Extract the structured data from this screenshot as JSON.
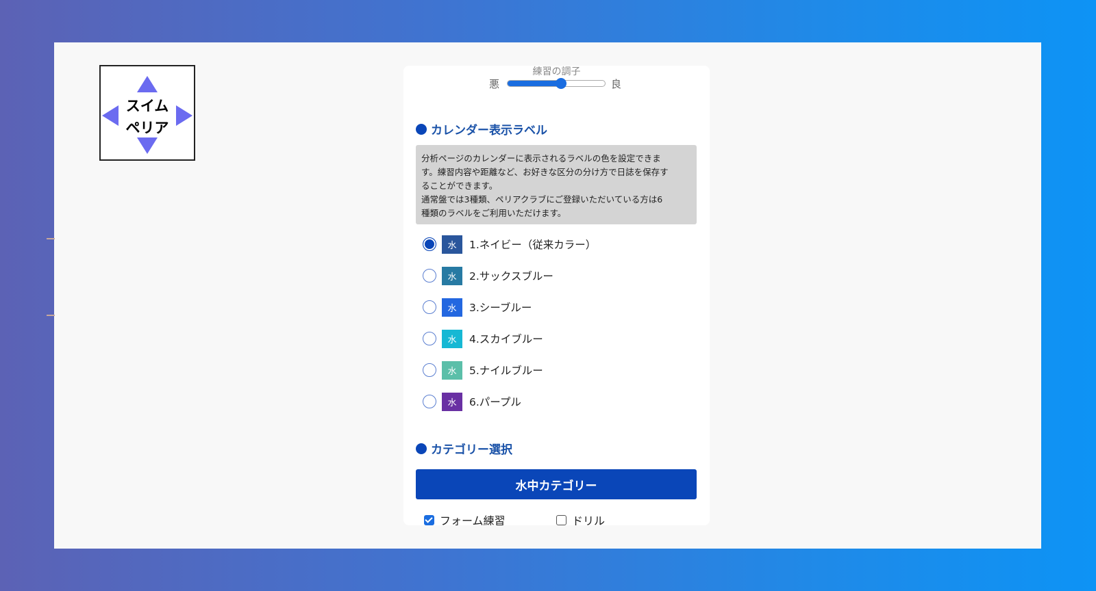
{
  "logo": {
    "line1": "スイム",
    "line2": "ペリア"
  },
  "slider": {
    "cut_label": "練習の調子",
    "left_label": "悪",
    "right_label": "良",
    "value_fraction": 0.55
  },
  "calendar": {
    "heading": "カレンダー表示ラベル",
    "info_lines": [
      "分析ページのカレンダーに表示されるラベルの色を設定できま",
      "す。練習内容や距離など、お好きな区分の分け方で日誌を保存す",
      "ることができます。",
      "通常盤では3種類、ペリアクラブにご登録いただいている方は6",
      "種類のラベルをご利用いただけます。"
    ],
    "options": [
      {
        "chip": "水",
        "label": "1.ネイビー（従来カラー）",
        "color": "#2a569c",
        "checked": true
      },
      {
        "chip": "水",
        "label": "2.サックスブルー",
        "color": "#277aa3",
        "checked": false
      },
      {
        "chip": "水",
        "label": "3.シーブルー",
        "color": "#2367e0",
        "checked": false
      },
      {
        "chip": "水",
        "label": "4.スカイブルー",
        "color": "#16b8d4",
        "checked": false
      },
      {
        "chip": "水",
        "label": "5.ナイルブルー",
        "color": "#5bbfa9",
        "checked": false
      },
      {
        "chip": "水",
        "label": "6.パープル",
        "color": "#6930a3",
        "checked": false
      }
    ]
  },
  "category": {
    "heading": "カテゴリー選択",
    "button_label": "水中カテゴリー",
    "checks": [
      {
        "label": "フォーム練習",
        "checked": true
      },
      {
        "label": "ドリル",
        "checked": false
      }
    ]
  },
  "colors": {
    "accent": "#0a46b8",
    "heading": "#1a52a8"
  }
}
